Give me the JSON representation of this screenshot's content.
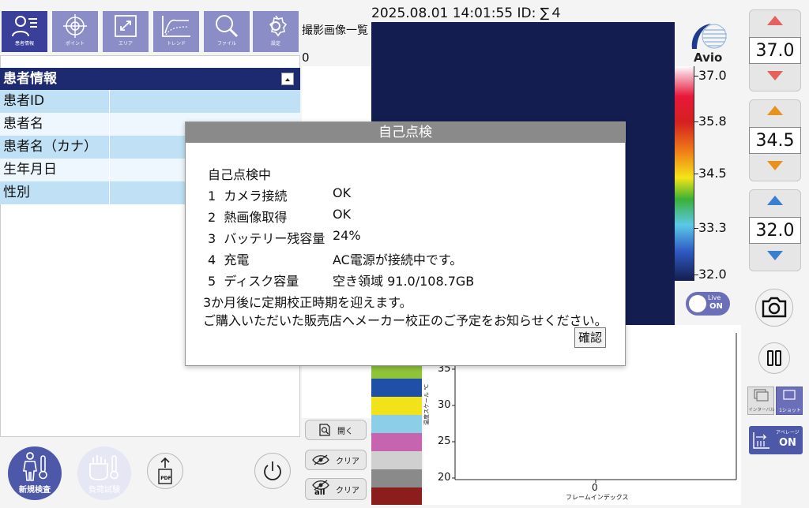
{
  "toolbar": {
    "items": [
      {
        "label": "患者情報",
        "icon": "patient-icon"
      },
      {
        "label": "ポイント",
        "icon": "target-icon"
      },
      {
        "label": "エリア",
        "icon": "area-icon"
      },
      {
        "label": "トレンド",
        "icon": "trend-icon"
      },
      {
        "label": "ファイル",
        "icon": "magnifier-icon"
      },
      {
        "label": "設定",
        "icon": "gear-icon"
      }
    ]
  },
  "header": {
    "datetime": "2025.08.01 14:01:55",
    "id_text": "ID: ∑４"
  },
  "gallery": {
    "title": "撮影画像一覧",
    "count": "0"
  },
  "patient": {
    "title": "患者情報",
    "fields": [
      "患者ID",
      "患者名",
      "患者名（カナ）",
      "生年月日",
      "性別"
    ]
  },
  "brand": {
    "logo_text": "Avio"
  },
  "scale": {
    "labels": [
      "37.0",
      "35.8",
      "34.5",
      "33.3",
      "32.0"
    ]
  },
  "controls": {
    "max_value": "37.0",
    "mid_value": "34.5",
    "min_value": "32.0",
    "live_label": "Live",
    "live_state": "ON",
    "interval_label": "インターバル",
    "oneshot_label": "1ショット",
    "average_label": "アベレージ",
    "average_state": "ON"
  },
  "dialog": {
    "title": "自己点検",
    "status": "自己点検中",
    "items": [
      {
        "num": "1",
        "name": "カメラ接続",
        "value": "OK"
      },
      {
        "num": "2",
        "name": "熱画像取得",
        "value": "OK"
      },
      {
        "num": "3",
        "name": "バッテリー残容量",
        "value": "24%"
      },
      {
        "num": "4",
        "name": "充電",
        "value": "AC電源が接続中です。"
      },
      {
        "num": "5",
        "name": "ディスク容量",
        "value": "空き領域 91.0/108.7GB"
      }
    ],
    "note1": "3か月後に定期校正時期を迎えます。",
    "note2": "ご購入いただいた販売店へメーカー校正のご予定をお知らせください。",
    "confirm_label": "確認"
  },
  "side_buttons": {
    "open_label": "開く",
    "clear_label": "クリア",
    "clear_all_label": "クリア",
    "all_label": "all"
  },
  "bottom": {
    "new_exam_label": "新規検査",
    "load_test_label": "負荷試験",
    "pdf_label": "PDF"
  },
  "palette": [
    "#8fc43a",
    "#1f4fa6",
    "#f2e219",
    "#8ccde8",
    "#c664b0",
    "#d0d0d0",
    "#8a8a8a",
    "#8c1d1d"
  ],
  "chart_data": {
    "type": "line",
    "xlabel": "フレームインデックス",
    "ylabel": "温度スケール ℃",
    "x_ticks": [
      "0"
    ],
    "y_ticks": [
      "35",
      "30",
      "25",
      "20"
    ],
    "series": []
  }
}
